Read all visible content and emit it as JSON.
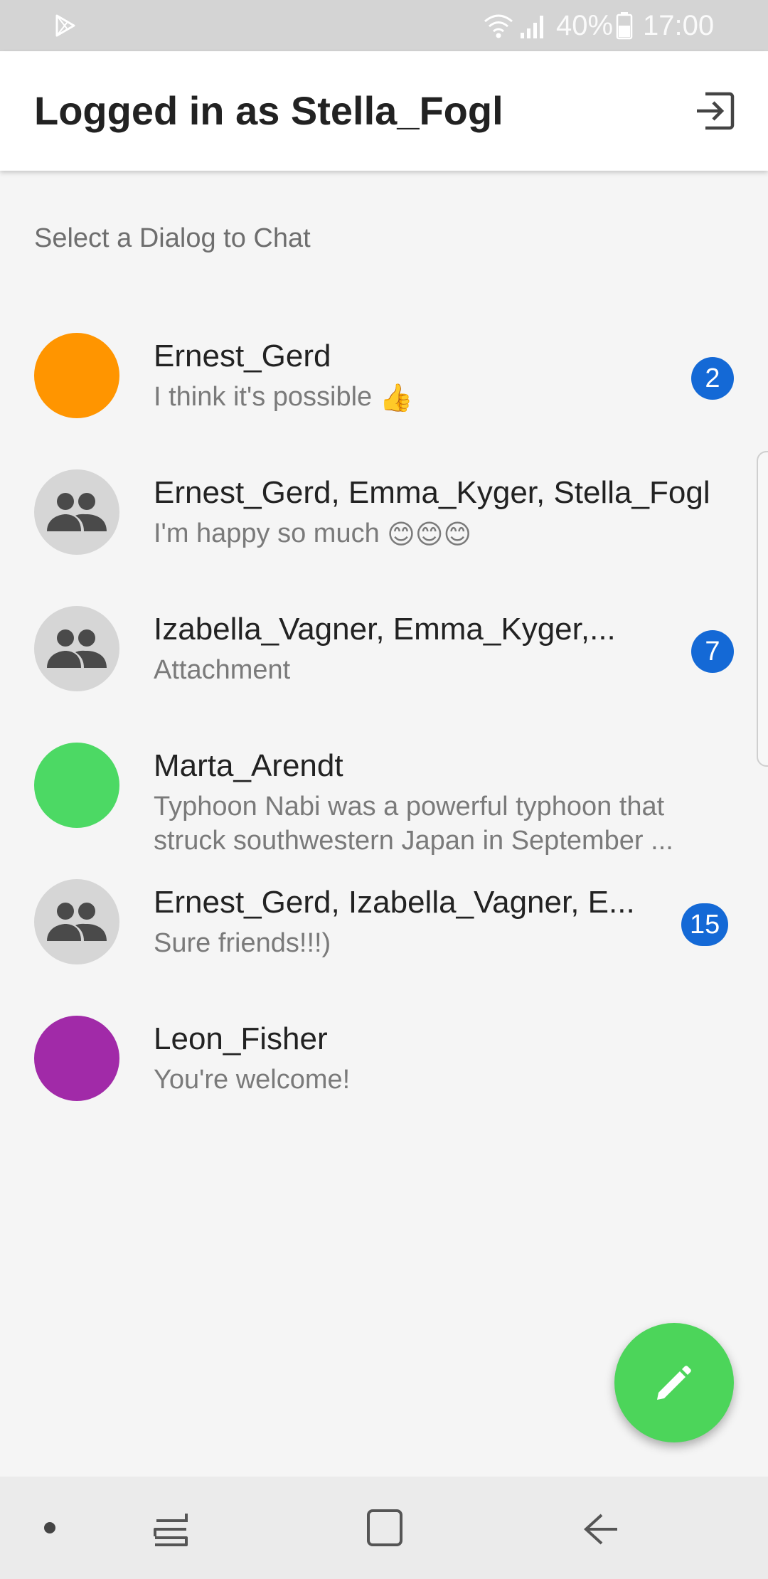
{
  "status_bar": {
    "battery_percent": "40%",
    "time": "17:00",
    "icons": [
      "play-store-icon",
      "wifi-icon",
      "signal-icon",
      "battery-icon"
    ]
  },
  "app_bar": {
    "title": "Logged in as Stella_Fogl",
    "logout_icon": "logout-icon"
  },
  "section_header": "Select a Dialog to Chat",
  "dialogs": [
    {
      "name": "Ernest_Gerd",
      "preview": "I think it's possible",
      "preview_emoji": "👍",
      "avatar_type": "color",
      "avatar_color": "#ff9500",
      "badge": "2"
    },
    {
      "name": "Ernest_Gerd, Emma_Kyger, Stella_Fogl",
      "preview": "I'm happy so much",
      "preview_emoji": "😊😊😊",
      "avatar_type": "group",
      "avatar_color": "#d6d6d6",
      "badge": ""
    },
    {
      "name": "Izabella_Vagner, Emma_Kyger,...",
      "preview": "Attachment",
      "preview_emoji": "",
      "avatar_type": "group",
      "avatar_color": "#d6d6d6",
      "badge": "7"
    },
    {
      "name": "Marta_Arendt",
      "preview": "Typhoon Nabi was a powerful typhoon that struck southwestern Japan in September ...",
      "preview_emoji": "",
      "avatar_type": "color",
      "avatar_color": "#4cd964",
      "badge": ""
    },
    {
      "name": "Ernest_Gerd, Izabella_Vagner, E...",
      "preview": "Sure friends!!!)",
      "preview_emoji": "",
      "avatar_type": "group",
      "avatar_color": "#d6d6d6",
      "badge": "15"
    },
    {
      "name": "Leon_Fisher",
      "preview": "You're welcome!",
      "preview_emoji": "",
      "avatar_type": "color",
      "avatar_color": "#a12aa8",
      "badge": ""
    }
  ],
  "fab": {
    "icon": "pencil-icon",
    "color": "#4cd55a"
  },
  "nav_bar": {
    "icons": [
      "nav-dot-icon",
      "recents-icon",
      "home-icon",
      "back-icon"
    ]
  },
  "colors": {
    "badge": "#1469d6",
    "group_avatar_icon": "#4a4a4a"
  }
}
